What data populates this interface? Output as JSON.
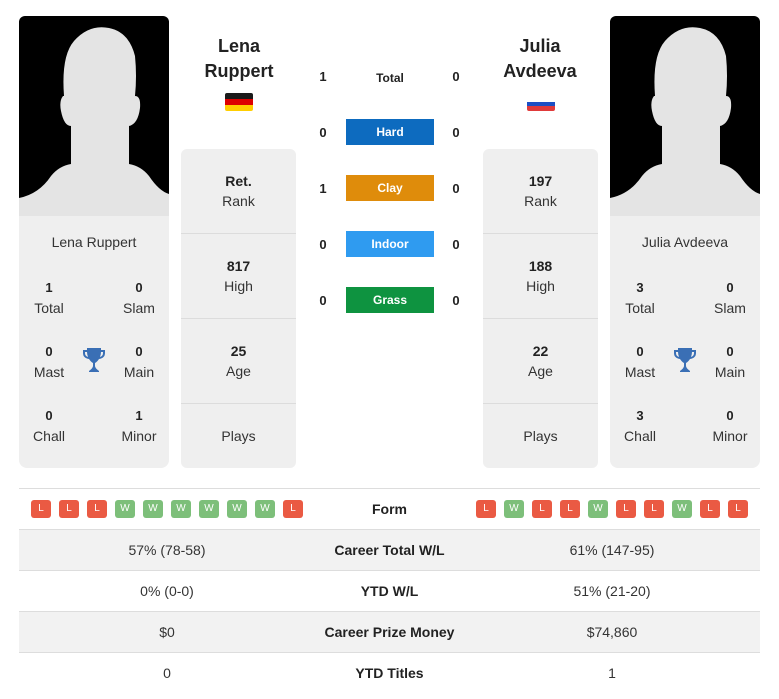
{
  "player1": {
    "name_line1": "Lena",
    "name_line2": "Ruppert",
    "full_name": "Lena Ruppert",
    "flag": "germany-flag",
    "rank": "Ret.",
    "rank_label": "Rank",
    "high": "817",
    "high_label": "High",
    "age": "25",
    "age_label": "Age",
    "plays_label": "Plays",
    "titles": {
      "total": "1",
      "total_label": "Total",
      "slam": "0",
      "slam_label": "Slam",
      "mast": "0",
      "mast_label": "Mast",
      "main": "0",
      "main_label": "Main",
      "chall": "0",
      "chall_label": "Chall",
      "minor": "1",
      "minor_label": "Minor"
    },
    "form": [
      "L",
      "L",
      "L",
      "W",
      "W",
      "W",
      "W",
      "W",
      "W",
      "L"
    ]
  },
  "player2": {
    "name_line1": "Julia",
    "name_line2": "Avdeeva",
    "full_name": "Julia Avdeeva",
    "flag": "russia-flag",
    "rank": "197",
    "rank_label": "Rank",
    "high": "188",
    "high_label": "High",
    "age": "22",
    "age_label": "Age",
    "plays_label": "Plays",
    "titles": {
      "total": "3",
      "total_label": "Total",
      "slam": "0",
      "slam_label": "Slam",
      "mast": "0",
      "mast_label": "Mast",
      "main": "0",
      "main_label": "Main",
      "chall": "3",
      "chall_label": "Chall",
      "minor": "0",
      "minor_label": "Minor"
    },
    "form": [
      "L",
      "W",
      "L",
      "L",
      "W",
      "L",
      "L",
      "W",
      "L",
      "L"
    ]
  },
  "h2h": {
    "total": {
      "label": "Total",
      "p1": "1",
      "p2": "0"
    },
    "surfaces": [
      {
        "label": "Hard",
        "p1": "0",
        "p2": "0",
        "color": "#0d6bbf"
      },
      {
        "label": "Clay",
        "p1": "1",
        "p2": "0",
        "color": "#df8c0b"
      },
      {
        "label": "Indoor",
        "p1": "0",
        "p2": "0",
        "color": "#2f9bf0"
      },
      {
        "label": "Grass",
        "p1": "0",
        "p2": "0",
        "color": "#0e9340"
      }
    ]
  },
  "comparison": {
    "form_label": "Form",
    "rows": [
      {
        "label": "Career Total W/L",
        "p1": "57% (78-58)",
        "p2": "61% (147-95)"
      },
      {
        "label": "YTD W/L",
        "p1": "0% (0-0)",
        "p2": "51% (21-20)"
      },
      {
        "label": "Career Prize Money",
        "p1": "$0",
        "p2": "$74,860"
      },
      {
        "label": "YTD Titles",
        "p1": "0",
        "p2": "1"
      }
    ]
  },
  "colors": {
    "loss": "#ea5a43",
    "win": "#7dbf7a",
    "trophy": "#3a6fb5"
  }
}
